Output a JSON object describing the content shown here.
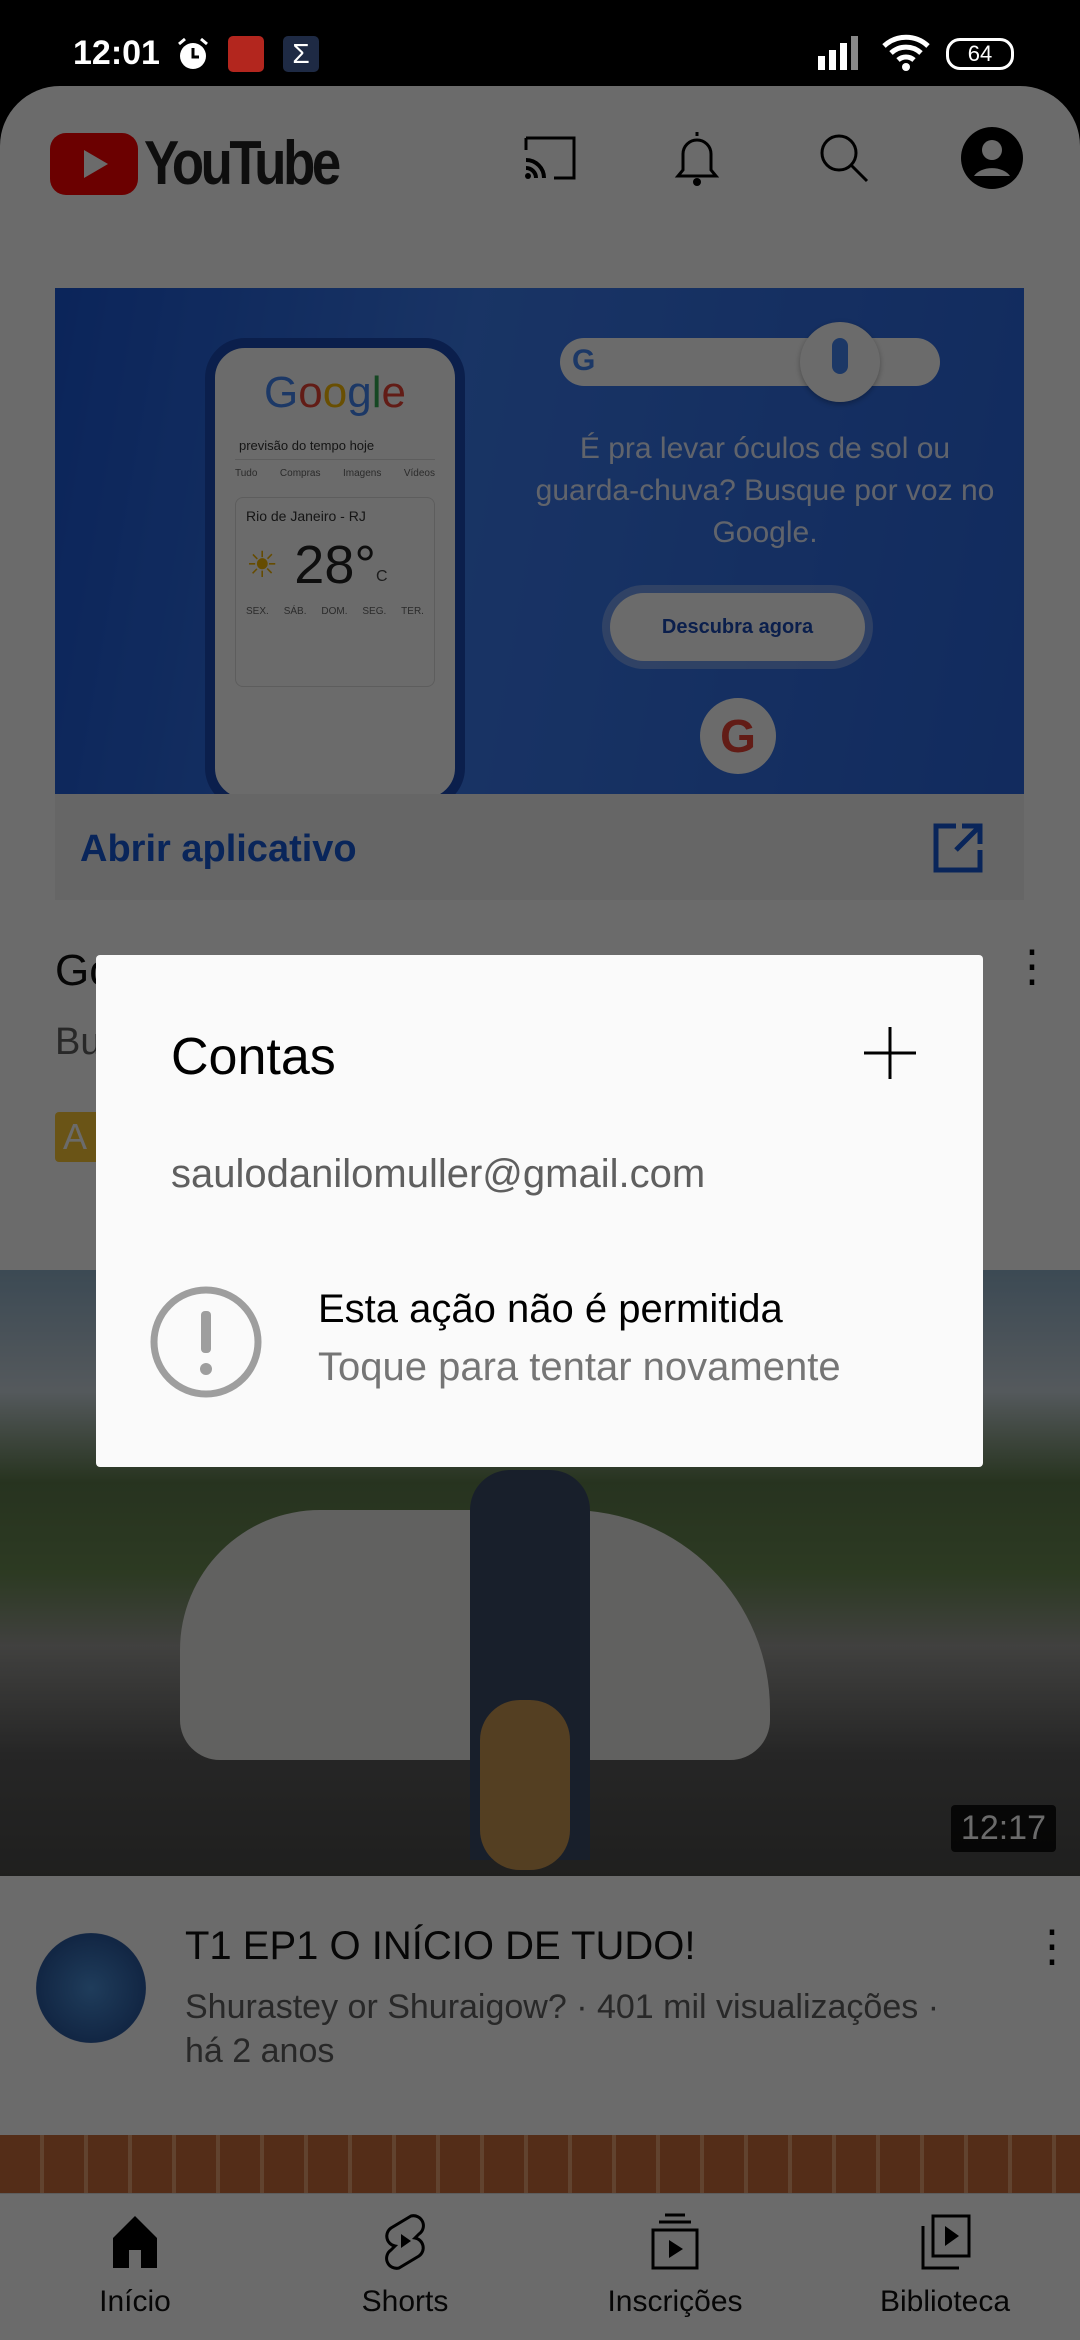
{
  "status_bar": {
    "time": "12:01",
    "battery": "64",
    "notification_icons": [
      "alarm-icon",
      "bible-app-icon",
      "sigma-app-icon"
    ]
  },
  "header": {
    "logo": "YouTube",
    "icons": [
      "cast-icon",
      "bell-icon",
      "search-icon",
      "account-icon"
    ]
  },
  "ad": {
    "banner": {
      "headline": "É pra levar óculos de sol ou guarda-chuva? Busque por voz no Google.",
      "cta": "Descubra agora",
      "phone_search": "previsão do tempo hoje",
      "phone_tabs": [
        "Tudo",
        "Compras",
        "Imagens",
        "Vídeos"
      ],
      "city": "Rio de Janeiro - RJ",
      "temperature": "28°",
      "unit": "C",
      "days": [
        "SEX.",
        "SÁB.",
        "DOM.",
        "SEG.",
        "TER."
      ]
    },
    "open_app_label": "Abrir aplicativo",
    "title_fragment": "Go",
    "subtitle_fragment": "Bu",
    "badge_fragment": "A"
  },
  "video": {
    "duration": "12:17",
    "title": "T1 EP1 O INÍCIO DE TUDO!",
    "meta_line1": "Shurastey or Shuraigow? · 401 mil visualizações ·",
    "meta_line2": "há 2 anos"
  },
  "nav": [
    {
      "label": "Início",
      "icon": "home-icon"
    },
    {
      "label": "Shorts",
      "icon": "shorts-icon"
    },
    {
      "label": "Inscrições",
      "icon": "subscriptions-icon"
    },
    {
      "label": "Biblioteca",
      "icon": "library-icon"
    }
  ],
  "dialog": {
    "title": "Contas",
    "email": "saulodanilomuller@gmail.com",
    "error_title": "Esta ação não é permitida",
    "error_subtitle": "Toque para tentar novamente"
  },
  "colors": {
    "youtube_red": "#ff0000",
    "link_blue": "#1558d6",
    "dim_overlay": "rgba(0,0,0,0.6)"
  }
}
